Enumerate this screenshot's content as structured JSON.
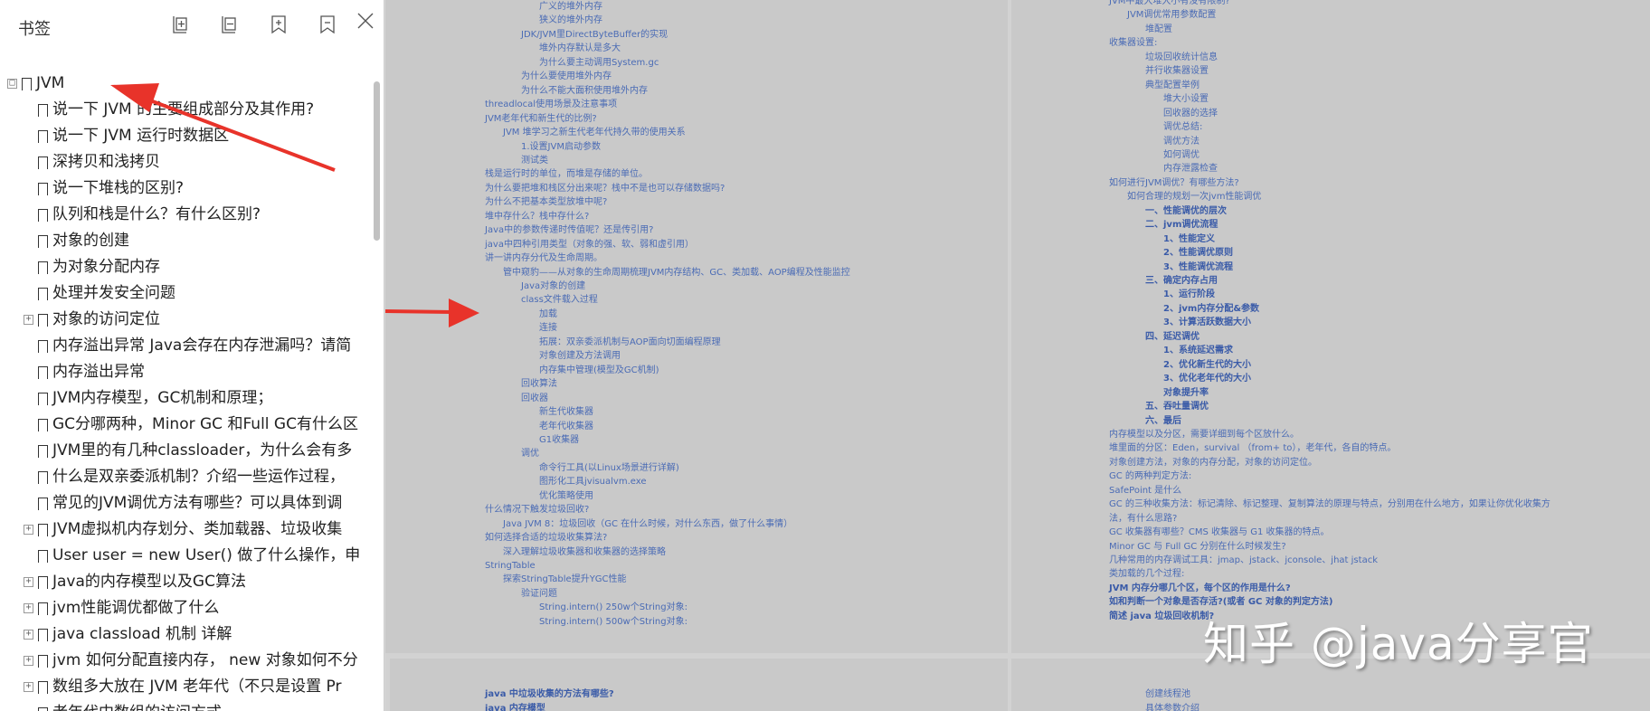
{
  "sidebar": {
    "title": "书签",
    "toolbar": [
      {
        "icon": "expand-all-icon"
      },
      {
        "icon": "collapse-all-icon"
      },
      {
        "icon": "add-bookmark-icon"
      },
      {
        "icon": "delete-bookmark-icon"
      },
      {
        "icon": "close-icon"
      }
    ],
    "items": [
      {
        "label": "JVM",
        "level": 0,
        "expander": "□"
      },
      {
        "label": "说一下 JVM 的主要组成部分及其作用?",
        "level": 1,
        "expander": ""
      },
      {
        "label": "说一下 JVM 运行时数据区",
        "level": 1,
        "expander": ""
      },
      {
        "label": "深拷贝和浅拷贝",
        "level": 1,
        "expander": ""
      },
      {
        "label": "说一下堆栈的区别?",
        "level": 1,
        "expander": ""
      },
      {
        "label": "队列和栈是什么？有什么区别?",
        "level": 1,
        "expander": ""
      },
      {
        "label": "对象的创建",
        "level": 1,
        "expander": ""
      },
      {
        "label": "为对象分配内存",
        "level": 1,
        "expander": ""
      },
      {
        "label": "处理并发安全问题",
        "level": 1,
        "expander": ""
      },
      {
        "label": "对象的访问定位",
        "level": 1,
        "expander": "+"
      },
      {
        "label": "内存溢出异常 Java会存在内存泄漏吗？请简",
        "level": 1,
        "expander": ""
      },
      {
        "label": "内存溢出异常",
        "level": 1,
        "expander": ""
      },
      {
        "label": "JVM内存模型，GC机制和原理；",
        "level": 1,
        "expander": ""
      },
      {
        "label": "GC分哪两种，Minor GC 和Full GC有什么区",
        "level": 1,
        "expander": ""
      },
      {
        "label": "JVM里的有几种classloader，为什么会有多",
        "level": 1,
        "expander": ""
      },
      {
        "label": "什么是双亲委派机制？介绍一些运作过程，",
        "level": 1,
        "expander": ""
      },
      {
        "label": "常见的JVM调优方法有哪些？可以具体到调",
        "level": 1,
        "expander": ""
      },
      {
        "label": "JVM虚拟机内存划分、类加载器、垃圾收集",
        "level": 1,
        "expander": "+"
      },
      {
        "label": "User user = new User()  做了什么操作，申",
        "level": 1,
        "expander": ""
      },
      {
        "label": "Java的内存模型以及GC算法",
        "level": 1,
        "expander": "+"
      },
      {
        "label": "jvm性能调优都做了什么",
        "level": 1,
        "expander": "+"
      },
      {
        "label": "java classload 机制 详解",
        "level": 1,
        "expander": "+"
      },
      {
        "label": "jvm 如何分配直接内存，  new 对象如何不分",
        "level": 1,
        "expander": "+"
      },
      {
        "label": "数组多大放在 JVM 老年代（不只是设置 Pr",
        "level": 1,
        "expander": "+"
      },
      {
        "label": "老年代中数组的访问方式",
        "level": 1,
        "expander": ""
      }
    ]
  },
  "doc": {
    "left_page_lines": [
      {
        "text": "广义的堆外内存",
        "indent": 3,
        "bold": false
      },
      {
        "text": "狭义的堆外内存",
        "indent": 3,
        "bold": false
      },
      {
        "text": "JDK/JVM里DirectByteBuffer的实现",
        "indent": 2,
        "bold": false
      },
      {
        "text": "堆外内存默认是多大",
        "indent": 3,
        "bold": false
      },
      {
        "text": "为什么要主动调用System.gc",
        "indent": 3,
        "bold": false
      },
      {
        "text": "为什么要使用堆外内存",
        "indent": 2,
        "bold": false
      },
      {
        "text": "为什么不能大面积使用堆外内存",
        "indent": 2,
        "bold": false
      },
      {
        "text": "threadlocal使用场景及注意事项",
        "indent": 0,
        "bold": false
      },
      {
        "text": "JVM老年代和新生代的比例?",
        "indent": 0,
        "bold": false
      },
      {
        "text": "JVM 堆学习之新生代老年代持久带的使用关系",
        "indent": 1,
        "bold": false
      },
      {
        "text": "1.设置JVM启动参数",
        "indent": 2,
        "bold": false
      },
      {
        "text": "测试类",
        "indent": 2,
        "bold": false
      },
      {
        "text": "栈是运行时的单位，而堆是存储的单位。",
        "indent": 0,
        "bold": false
      },
      {
        "text": "为什么要把堆和栈区分出来呢？栈中不是也可以存储数据吗?",
        "indent": 0,
        "bold": false
      },
      {
        "text": "为什么不把基本类型放堆中呢?",
        "indent": 0,
        "bold": false
      },
      {
        "text": "堆中存什么？栈中存什么?",
        "indent": 0,
        "bold": false
      },
      {
        "text": "Java中的参数传递时传值呢？还是传引用?",
        "indent": 0,
        "bold": false
      },
      {
        "text": "java中四种引用类型（对象的强、软、弱和虚引用）",
        "indent": 0,
        "bold": false
      },
      {
        "text": "讲一讲内存分代及生命周期。",
        "indent": 0,
        "bold": false
      },
      {
        "text": "管中窥豹——从对象的生命周期梳理JVM内存结构、GC、类加载、AOP编程及性能监控",
        "indent": 1,
        "bold": false
      },
      {
        "text": "Java对象的创建",
        "indent": 2,
        "bold": false
      },
      {
        "text": "class文件载入过程",
        "indent": 2,
        "bold": false
      },
      {
        "text": "加载",
        "indent": 3,
        "bold": false
      },
      {
        "text": "连接",
        "indent": 3,
        "bold": false
      },
      {
        "text": "拓展：双亲委派机制与AOP面向切面编程原理",
        "indent": 3,
        "bold": false
      },
      {
        "text": "对象创建及方法调用",
        "indent": 3,
        "bold": false
      },
      {
        "text": "内存集中管理(模型及GC机制)",
        "indent": 3,
        "bold": false
      },
      {
        "text": "回收算法",
        "indent": 2,
        "bold": false
      },
      {
        "text": "回收器",
        "indent": 2,
        "bold": false
      },
      {
        "text": "新生代收集器",
        "indent": 3,
        "bold": false
      },
      {
        "text": "老年代收集器",
        "indent": 3,
        "bold": false
      },
      {
        "text": "G1收集器",
        "indent": 3,
        "bold": false
      },
      {
        "text": "调优",
        "indent": 2,
        "bold": false
      },
      {
        "text": "命令行工具(以Linux场景进行详解)",
        "indent": 3,
        "bold": false
      },
      {
        "text": "图形化工具jvisualvm.exe",
        "indent": 3,
        "bold": false
      },
      {
        "text": "优化策略使用",
        "indent": 3,
        "bold": false
      },
      {
        "text": "什么情况下触发垃圾回收?",
        "indent": 0,
        "bold": false
      },
      {
        "text": "Java JVM 8：垃圾回收（GC 在什么时候，对什么东西，做了什么事情）",
        "indent": 1,
        "bold": false
      },
      {
        "text": "如何选择合适的垃圾收集算法?",
        "indent": 0,
        "bold": false
      },
      {
        "text": "深入理解垃圾收集器和收集器的选择策略",
        "indent": 1,
        "bold": false
      },
      {
        "text": "StringTable",
        "indent": 0,
        "bold": false
      },
      {
        "text": "探索StringTable提升YGC性能",
        "indent": 1,
        "bold": false
      },
      {
        "text": "验证问题",
        "indent": 2,
        "bold": false
      },
      {
        "text": "String.intern() 250w个String对象:",
        "indent": 3,
        "bold": false
      },
      {
        "text": "String.intern() 500w个String对象:",
        "indent": 3,
        "bold": false
      }
    ],
    "right_page_lines": [
      {
        "text": "JVM中最大堆大小有没有限制?",
        "indent": 0,
        "bold": false
      },
      {
        "text": "JVM调优常用参数配置",
        "indent": 1,
        "bold": false
      },
      {
        "text": "堆配置",
        "indent": 2,
        "bold": false
      },
      {
        "text": "收集器设置:",
        "indent": 0,
        "bold": false
      },
      {
        "text": "垃圾回收统计信息",
        "indent": 2,
        "bold": false
      },
      {
        "text": "并行收集器设置",
        "indent": 2,
        "bold": false
      },
      {
        "text": "典型配置举例",
        "indent": 2,
        "bold": false
      },
      {
        "text": "堆大小设置",
        "indent": 3,
        "bold": false
      },
      {
        "text": "回收器的选择",
        "indent": 3,
        "bold": false
      },
      {
        "text": "调优总结:",
        "indent": 3,
        "bold": false
      },
      {
        "text": "调优方法",
        "indent": 3,
        "bold": false
      },
      {
        "text": "如何调优",
        "indent": 3,
        "bold": false
      },
      {
        "text": "内存泄露检查",
        "indent": 3,
        "bold": false
      },
      {
        "text": "如何进行JVM调优？有哪些方法?",
        "indent": 0,
        "bold": false
      },
      {
        "text": "如何合理的规划一次jvm性能调优",
        "indent": 1,
        "bold": false
      },
      {
        "text": "一、性能调优的层次",
        "indent": 2,
        "bold": true
      },
      {
        "text": "二、jvm调优流程",
        "indent": 2,
        "bold": true
      },
      {
        "text": "1、性能定义",
        "indent": 3,
        "bold": true
      },
      {
        "text": "2、性能调优原则",
        "indent": 3,
        "bold": true
      },
      {
        "text": "3、性能调优流程",
        "indent": 3,
        "bold": true
      },
      {
        "text": "三、确定内存占用",
        "indent": 2,
        "bold": true
      },
      {
        "text": "1、运行阶段",
        "indent": 3,
        "bold": true
      },
      {
        "text": "2、jvm内存分配&参数",
        "indent": 3,
        "bold": true
      },
      {
        "text": "3、计算活跃数据大小",
        "indent": 3,
        "bold": true
      },
      {
        "text": "四、延迟调优",
        "indent": 2,
        "bold": true
      },
      {
        "text": "1、系统延迟需求",
        "indent": 3,
        "bold": true
      },
      {
        "text": "2、优化新生代的大小",
        "indent": 3,
        "bold": true
      },
      {
        "text": "3、优化老年代的大小",
        "indent": 3,
        "bold": true
      },
      {
        "text": "对象提升率",
        "indent": 3,
        "bold": true
      },
      {
        "text": "五、吞吐量调优",
        "indent": 2,
        "bold": true
      },
      {
        "text": "六、最后",
        "indent": 2,
        "bold": true
      },
      {
        "text": "内存模型以及分区，需要详细到每个区放什么。",
        "indent": 0,
        "bold": false
      },
      {
        "text": "堆里面的分区：Eden，survival （from+ to），老年代，各自的特点。",
        "indent": 0,
        "bold": false
      },
      {
        "text": "对象创建方法，对象的内存分配，对象的访问定位。",
        "indent": 0,
        "bold": false
      },
      {
        "text": "GC 的两种判定方法:",
        "indent": 0,
        "bold": false
      },
      {
        "text": "SafePoint 是什么",
        "indent": 0,
        "bold": false
      },
      {
        "text": "GC 的三种收集方法：标记清除、标记整理、复制算法的原理与特点，分别用在什么地方，如果让你优化收集方",
        "indent": 0,
        "bold": false
      },
      {
        "text": "法，有什么思路?",
        "indent": 0,
        "bold": false
      },
      {
        "text": "GC 收集器有哪些？CMS 收集器与 G1 收集器的特点。",
        "indent": 0,
        "bold": false
      },
      {
        "text": "Minor GC 与 Full GC 分别在什么时候发生?",
        "indent": 0,
        "bold": false
      },
      {
        "text": "几种常用的内存调试工具：jmap、jstack、jconsole、jhat jstack",
        "indent": 0,
        "bold": false
      },
      {
        "text": "类加载的几个过程:",
        "indent": 0,
        "bold": false
      },
      {
        "text": "JVM 内存分哪几个区，每个区的作用是什么?",
        "indent": 0,
        "bold": true
      },
      {
        "text": "如和判断一个对象是否存活?(或者 GC 对象的判定方法)",
        "indent": 0,
        "bold": true
      },
      {
        "text": "简述 java 垃圾回收机制?",
        "indent": 0,
        "bold": true
      }
    ],
    "left_page2_lines": [
      {
        "text": "java 中垃圾收集的方法有哪些?",
        "indent": 0,
        "bold": true
      },
      {
        "text": "java 内存模型",
        "indent": 0,
        "bold": true
      }
    ],
    "right_page2_lines": [
      {
        "text": "创建线程池",
        "indent": 2,
        "bold": false
      },
      {
        "text": "具体参数介绍",
        "indent": 2,
        "bold": false
      }
    ]
  },
  "watermark": "知乎 @java分享官",
  "colors": {
    "link_blue": "#4a6bb5",
    "arrow_red": "#e8332a",
    "sidebar_bg": "#ffffff",
    "doc_bg": "#d2d2d2"
  }
}
